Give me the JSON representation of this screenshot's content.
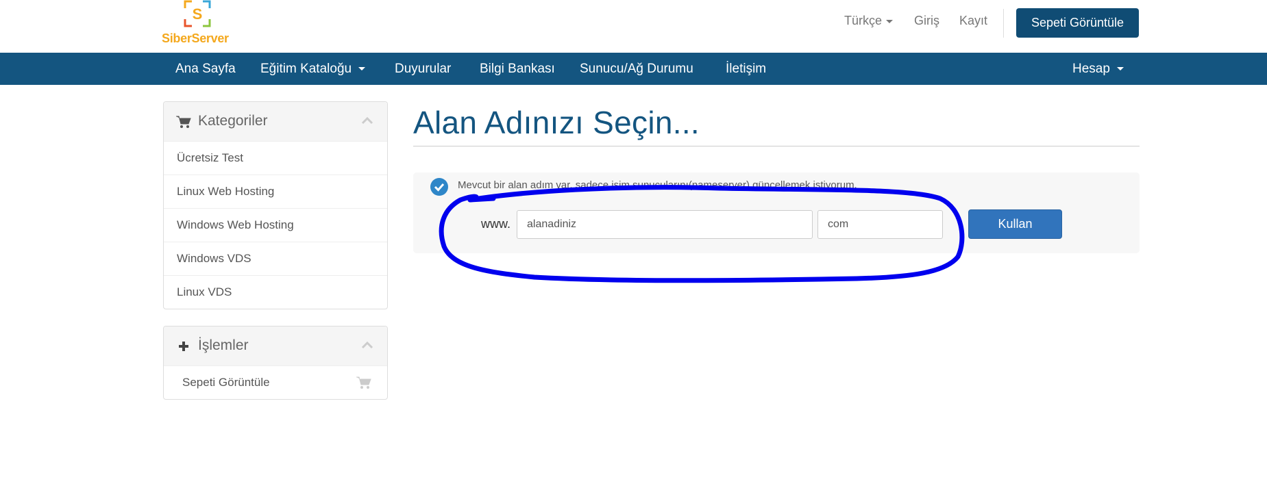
{
  "brand": {
    "name": "SiberServer",
    "mark_letter": "S"
  },
  "topbar": {
    "language": "Türkçe",
    "login": "Giriş",
    "register": "Kayıt",
    "view_cart": "Sepeti Görüntüle"
  },
  "nav": {
    "items": [
      {
        "label": "Ana Sayfa"
      },
      {
        "label": "Eğitim Kataloğu"
      },
      {
        "label": "Duyurular"
      },
      {
        "label": "Bilgi Bankası"
      },
      {
        "label": "Sunucu/Ağ Durumu"
      },
      {
        "label": "İletişim"
      }
    ],
    "account": "Hesap"
  },
  "sidebar": {
    "categories": {
      "title": "Kategoriler",
      "items": [
        "Ücretsiz Test",
        "Linux Web Hosting",
        "Windows Web Hosting",
        "Windows VDS",
        "Linux VDS"
      ]
    },
    "actions": {
      "title": "İşlemler",
      "items": [
        "Sepeti Görüntüle"
      ]
    }
  },
  "main": {
    "title": "Alan Adınızı Seçin...",
    "option_label": "Mevcut bir alan adım var, sadece isim sunucularını(nameserver) güncellemek istiyorum.",
    "www_prefix": "www.",
    "sld_value": "alanadiniz",
    "tld_value": "com",
    "use_button": "Kullan"
  },
  "colors": {
    "brand": "#145580",
    "button_blue": "#3174bc",
    "logo_orange": "#f4a81d",
    "annotation": "#0000ee"
  }
}
